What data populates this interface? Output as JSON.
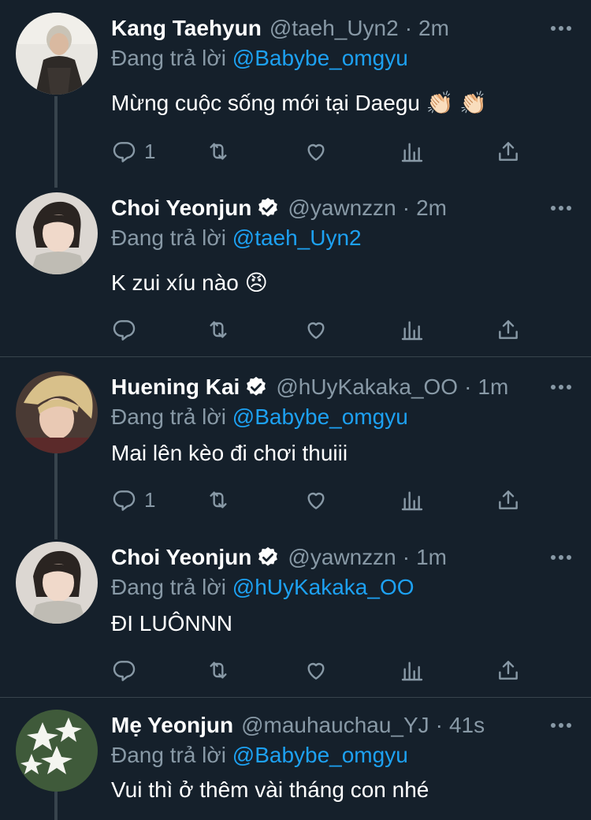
{
  "reply_prefix": "Đang trả lời",
  "tweets": [
    {
      "name": "Kang Taehyun",
      "verified": false,
      "handle": "@taeh_Uyn2",
      "time": "2m",
      "replying_to": "@Babybe_omgyu",
      "text": "Mừng cuộc sống mới tại Daegu 👏🏻 👏🏻",
      "reply_count": "1"
    },
    {
      "name": "Choi Yeonjun",
      "verified": true,
      "handle": "@yawnzzn",
      "time": "2m",
      "replying_to": "@taeh_Uyn2",
      "text": "K zui xíu nào 😠",
      "reply_count": ""
    },
    {
      "name": "Huening Kai",
      "verified": true,
      "handle": "@hUyKakaka_OO",
      "time": "1m",
      "replying_to": "@Babybe_omgyu",
      "text": "Mai lên kèo đi chơi thuiii",
      "reply_count": "1"
    },
    {
      "name": "Choi Yeonjun",
      "verified": true,
      "handle": "@yawnzzn",
      "time": "1m",
      "replying_to": "@hUyKakaka_OO",
      "text": "ĐI LUÔNNN",
      "reply_count": ""
    },
    {
      "name": "Mẹ Yeonjun",
      "verified": false,
      "handle": "@mauhauchau_YJ",
      "time": "41s",
      "replying_to": "@Babybe_omgyu",
      "text": "Vui thì ở thêm vài tháng con nhé",
      "reply_count": ""
    }
  ],
  "time_separator": "·",
  "icons": [
    "reply-icon",
    "retweet-icon",
    "like-icon",
    "analytics-icon",
    "share-icon",
    "more-icon",
    "verified-icon"
  ],
  "colors": {
    "background": "#15202b",
    "muted": "#8899a6",
    "link": "#1da1f2",
    "border": "#38444d"
  }
}
